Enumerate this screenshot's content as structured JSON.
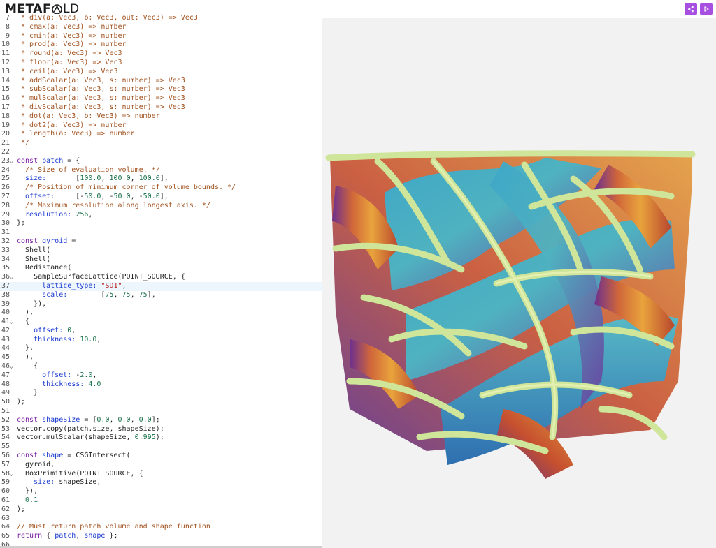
{
  "app": {
    "logo_left": "METAF",
    "logo_right": "LD",
    "logo_full": "METAFOLD"
  },
  "toolbar": {
    "share_icon": "share-icon",
    "run_icon": "play-icon",
    "accent": "#a74fe0"
  },
  "editor": {
    "active_line": "37",
    "lines": [
      {
        "n": "7",
        "fold": "",
        "parts": [
          [
            "c-cm",
            " * div(a: Vec3, b: Vec3, out: Vec3) => Vec3"
          ]
        ]
      },
      {
        "n": "8",
        "fold": "",
        "parts": [
          [
            "c-cm",
            " * cmax(a: Vec3) => number"
          ]
        ]
      },
      {
        "n": "9",
        "fold": "",
        "parts": [
          [
            "c-cm",
            " * cmin(a: Vec3) => number"
          ]
        ]
      },
      {
        "n": "10",
        "fold": "",
        "parts": [
          [
            "c-cm",
            " * prod(a: Vec3) => number"
          ]
        ]
      },
      {
        "n": "11",
        "fold": "",
        "parts": [
          [
            "c-cm",
            " * round(a: Vec3) => Vec3"
          ]
        ]
      },
      {
        "n": "12",
        "fold": "",
        "parts": [
          [
            "c-cm",
            " * floor(a: Vec3) => Vec3"
          ]
        ]
      },
      {
        "n": "13",
        "fold": "",
        "parts": [
          [
            "c-cm",
            " * ceil(a: Vec3) => Vec3"
          ]
        ]
      },
      {
        "n": "14",
        "fold": "",
        "parts": [
          [
            "c-cm",
            " * addScalar(a: Vec3, s: number) => Vec3"
          ]
        ]
      },
      {
        "n": "15",
        "fold": "",
        "parts": [
          [
            "c-cm",
            " * subScalar(a: Vec3, s: number) => Vec3"
          ]
        ]
      },
      {
        "n": "16",
        "fold": "",
        "parts": [
          [
            "c-cm",
            " * mulScalar(a: Vec3, s: number) => Vec3"
          ]
        ]
      },
      {
        "n": "17",
        "fold": "",
        "parts": [
          [
            "c-cm",
            " * divScalar(a: Vec3, s: number) => Vec3"
          ]
        ]
      },
      {
        "n": "18",
        "fold": "",
        "parts": [
          [
            "c-cm",
            " * dot(a: Vec3, b: Vec3) => number"
          ]
        ]
      },
      {
        "n": "19",
        "fold": "",
        "parts": [
          [
            "c-cm",
            " * dot2(a: Vec3) => number"
          ]
        ]
      },
      {
        "n": "20",
        "fold": "",
        "parts": [
          [
            "c-cm",
            " * length(a: Vec3) => number"
          ]
        ]
      },
      {
        "n": "21",
        "fold": "",
        "parts": [
          [
            "c-cm",
            " */"
          ]
        ]
      },
      {
        "n": "22",
        "fold": "",
        "parts": []
      },
      {
        "n": "23",
        "fold": "⌄",
        "parts": [
          [
            "c-kw",
            "const "
          ],
          [
            "c-def",
            "patch"
          ],
          [
            "",
            " = {"
          ]
        ]
      },
      {
        "n": "24",
        "fold": "",
        "parts": [
          [
            "c-cm",
            "  /* Size of evaluation volume. */"
          ]
        ]
      },
      {
        "n": "25",
        "fold": "",
        "parts": [
          [
            "c-prop",
            "  size:"
          ],
          [
            "",
            "       ["
          ],
          [
            "c-num",
            "100.0"
          ],
          [
            "",
            ", "
          ],
          [
            "c-num",
            "100.0"
          ],
          [
            "",
            ", "
          ],
          [
            "c-num",
            "100.0"
          ],
          [
            "",
            "],"
          ]
        ]
      },
      {
        "n": "26",
        "fold": "",
        "parts": [
          [
            "c-cm",
            "  /* Position of minimum corner of volume bounds. */"
          ]
        ]
      },
      {
        "n": "27",
        "fold": "",
        "parts": [
          [
            "c-prop",
            "  offset:"
          ],
          [
            "",
            "     [-"
          ],
          [
            "c-num",
            "50.0"
          ],
          [
            "",
            ", -"
          ],
          [
            "c-num",
            "50.0"
          ],
          [
            "",
            ", -"
          ],
          [
            "c-num",
            "50.0"
          ],
          [
            "",
            "],"
          ]
        ]
      },
      {
        "n": "28",
        "fold": "",
        "parts": [
          [
            "c-cm",
            "  /* Maximum resolution along longest axis. */"
          ]
        ]
      },
      {
        "n": "29",
        "fold": "",
        "parts": [
          [
            "c-prop",
            "  resolution:"
          ],
          [
            "",
            " "
          ],
          [
            "c-num",
            "256"
          ],
          [
            "",
            ","
          ]
        ]
      },
      {
        "n": "30",
        "fold": "",
        "parts": [
          [
            "",
            "};"
          ]
        ]
      },
      {
        "n": "31",
        "fold": "",
        "parts": []
      },
      {
        "n": "32",
        "fold": "",
        "parts": [
          [
            "c-kw",
            "const "
          ],
          [
            "c-def",
            "gyroid"
          ],
          [
            "",
            " ="
          ]
        ]
      },
      {
        "n": "33",
        "fold": "",
        "parts": [
          [
            "",
            "  Shell("
          ]
        ]
      },
      {
        "n": "34",
        "fold": "",
        "parts": [
          [
            "",
            "  Shell("
          ]
        ]
      },
      {
        "n": "35",
        "fold": "",
        "parts": [
          [
            "",
            "  Redistance("
          ]
        ]
      },
      {
        "n": "36",
        "fold": "⌄",
        "parts": [
          [
            "",
            "    SampleSurfaceLattice(POINT_SOURCE, {"
          ]
        ]
      },
      {
        "n": "37",
        "fold": "",
        "parts": [
          [
            "c-prop",
            "      lattice_type:"
          ],
          [
            "",
            " "
          ],
          [
            "c-str",
            "\"SD1\""
          ],
          [
            "",
            ","
          ]
        ]
      },
      {
        "n": "38",
        "fold": "",
        "parts": [
          [
            "c-prop",
            "      scale:"
          ],
          [
            "",
            "        ["
          ],
          [
            "c-num",
            "75"
          ],
          [
            "",
            ", "
          ],
          [
            "c-num",
            "75"
          ],
          [
            "",
            ", "
          ],
          [
            "c-num",
            "75"
          ],
          [
            "",
            "],"
          ]
        ]
      },
      {
        "n": "39",
        "fold": "",
        "parts": [
          [
            "",
            "    }),"
          ]
        ]
      },
      {
        "n": "40",
        "fold": "",
        "parts": [
          [
            "",
            "  ),"
          ]
        ]
      },
      {
        "n": "41",
        "fold": "⌄",
        "parts": [
          [
            "",
            "  {"
          ]
        ]
      },
      {
        "n": "42",
        "fold": "",
        "parts": [
          [
            "c-prop",
            "    offset:"
          ],
          [
            "",
            " "
          ],
          [
            "c-num",
            "0"
          ],
          [
            "",
            ","
          ]
        ]
      },
      {
        "n": "43",
        "fold": "",
        "parts": [
          [
            "c-prop",
            "    thickness:"
          ],
          [
            "",
            " "
          ],
          [
            "c-num",
            "10.0"
          ],
          [
            "",
            ","
          ]
        ]
      },
      {
        "n": "44",
        "fold": "",
        "parts": [
          [
            "",
            "  },"
          ]
        ]
      },
      {
        "n": "45",
        "fold": "",
        "parts": [
          [
            "",
            "  ),"
          ]
        ]
      },
      {
        "n": "46",
        "fold": "⌄",
        "parts": [
          [
            "",
            "    {"
          ]
        ]
      },
      {
        "n": "47",
        "fold": "",
        "parts": [
          [
            "c-prop",
            "      offset:"
          ],
          [
            "",
            " -"
          ],
          [
            "c-num",
            "2.0"
          ],
          [
            "",
            ","
          ]
        ]
      },
      {
        "n": "48",
        "fold": "",
        "parts": [
          [
            "c-prop",
            "      thickness:"
          ],
          [
            "",
            " "
          ],
          [
            "c-num",
            "4.0"
          ]
        ]
      },
      {
        "n": "49",
        "fold": "",
        "parts": [
          [
            "",
            "    }"
          ]
        ]
      },
      {
        "n": "50",
        "fold": "",
        "parts": [
          [
            "",
            ");"
          ]
        ]
      },
      {
        "n": "51",
        "fold": "",
        "parts": []
      },
      {
        "n": "52",
        "fold": "",
        "parts": [
          [
            "c-kw",
            "const "
          ],
          [
            "c-def",
            "shapeSize"
          ],
          [
            "",
            " = ["
          ],
          [
            "c-num",
            "0.0"
          ],
          [
            "",
            ", "
          ],
          [
            "c-num",
            "0.0"
          ],
          [
            "",
            ", "
          ],
          [
            "c-num",
            "0.0"
          ],
          [
            "",
            "];"
          ]
        ]
      },
      {
        "n": "53",
        "fold": "",
        "parts": [
          [
            "",
            "vector.copy(patch.size, shapeSize);"
          ]
        ]
      },
      {
        "n": "54",
        "fold": "",
        "parts": [
          [
            "",
            "vector.mulScalar(shapeSize, "
          ],
          [
            "c-num",
            "0.995"
          ],
          [
            "",
            ");"
          ]
        ]
      },
      {
        "n": "55",
        "fold": "",
        "parts": []
      },
      {
        "n": "56",
        "fold": "",
        "parts": [
          [
            "c-kw",
            "const "
          ],
          [
            "c-def",
            "shape"
          ],
          [
            "",
            " = CSGIntersect("
          ]
        ]
      },
      {
        "n": "57",
        "fold": "",
        "parts": [
          [
            "",
            "  gyroid,"
          ]
        ]
      },
      {
        "n": "58",
        "fold": "⌄",
        "parts": [
          [
            "",
            "  BoxPrimitive(POINT_SOURCE, {"
          ]
        ]
      },
      {
        "n": "59",
        "fold": "",
        "parts": [
          [
            "c-prop",
            "    size:"
          ],
          [
            "",
            " shapeSize,"
          ]
        ]
      },
      {
        "n": "60",
        "fold": "",
        "parts": [
          [
            "",
            "  }),"
          ]
        ]
      },
      {
        "n": "61",
        "fold": "",
        "parts": [
          [
            "c-num",
            "  0.1"
          ]
        ]
      },
      {
        "n": "62",
        "fold": "",
        "parts": [
          [
            "",
            ");"
          ]
        ]
      },
      {
        "n": "63",
        "fold": "",
        "parts": []
      },
      {
        "n": "64",
        "fold": "",
        "parts": [
          [
            "c-cm",
            "// Must return patch volume and shape function"
          ]
        ]
      },
      {
        "n": "65",
        "fold": "",
        "parts": [
          [
            "c-kw",
            "return"
          ],
          [
            "",
            " { "
          ],
          [
            "c-prop",
            "patch"
          ],
          [
            "",
            ", "
          ],
          [
            "c-prop",
            "shape"
          ],
          [
            "",
            " };"
          ]
        ]
      },
      {
        "n": "66",
        "fold": "",
        "parts": []
      }
    ]
  },
  "viewport": {
    "render": "gyroid-lattice-render",
    "background": "#f2f2f2"
  }
}
